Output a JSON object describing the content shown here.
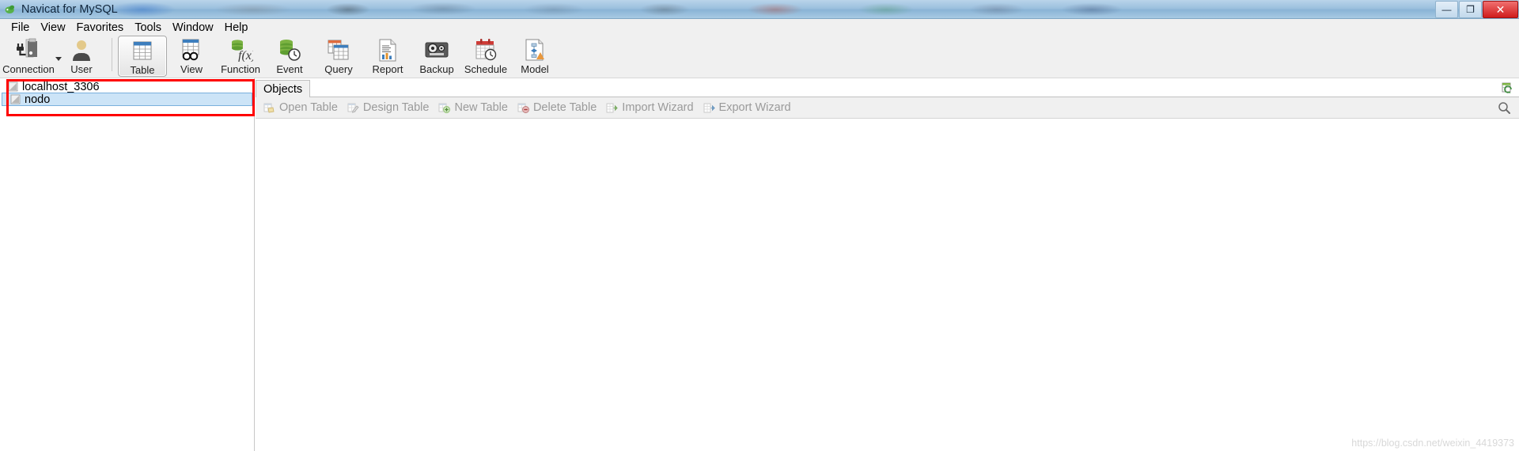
{
  "window": {
    "title": "Navicat for MySQL",
    "app_icon": "navicat-logo-icon",
    "minimize_label": "—",
    "maximize_label": "❐",
    "close_label": "✕"
  },
  "menubar": {
    "items": [
      {
        "label": "File",
        "name": "menu-file"
      },
      {
        "label": "View",
        "name": "menu-view"
      },
      {
        "label": "Favorites",
        "name": "menu-favorites"
      },
      {
        "label": "Tools",
        "name": "menu-tools"
      },
      {
        "label": "Window",
        "name": "menu-window"
      },
      {
        "label": "Help",
        "name": "menu-help"
      }
    ]
  },
  "toolbar": {
    "group1": [
      {
        "label": "Connection",
        "icon": "connection-icon",
        "has_dropdown": true,
        "active": false
      },
      {
        "label": "User",
        "icon": "user-icon",
        "has_dropdown": false,
        "active": false
      }
    ],
    "group2": [
      {
        "label": "Table",
        "icon": "table-icon",
        "has_dropdown": false,
        "active": true
      },
      {
        "label": "View",
        "icon": "view-icon",
        "has_dropdown": false,
        "active": false
      },
      {
        "label": "Function",
        "icon": "function-icon",
        "has_dropdown": false,
        "active": false
      },
      {
        "label": "Event",
        "icon": "event-icon",
        "has_dropdown": false,
        "active": false
      },
      {
        "label": "Query",
        "icon": "query-icon",
        "has_dropdown": false,
        "active": false
      },
      {
        "label": "Report",
        "icon": "report-icon",
        "has_dropdown": false,
        "active": false
      },
      {
        "label": "Backup",
        "icon": "backup-icon",
        "has_dropdown": false,
        "active": false
      },
      {
        "label": "Schedule",
        "icon": "schedule-icon",
        "has_dropdown": false,
        "active": false
      },
      {
        "label": "Model",
        "icon": "model-icon",
        "has_dropdown": false,
        "active": false
      }
    ]
  },
  "tree": {
    "items": [
      {
        "label": "localhost_3306",
        "icon": "connection-node-icon",
        "selected": false,
        "indent": 0
      },
      {
        "label": "nodo",
        "icon": "database-node-icon",
        "selected": true,
        "indent": 0
      }
    ],
    "highlight_color": "#ff0000"
  },
  "right_pane": {
    "tabs": [
      {
        "label": "Objects",
        "active": true
      }
    ],
    "refresh_icon": "refresh-icon",
    "actions": [
      {
        "label": "Open Table",
        "icon": "open-table-icon"
      },
      {
        "label": "Design Table",
        "icon": "design-table-icon"
      },
      {
        "label": "New Table",
        "icon": "new-table-icon"
      },
      {
        "label": "Delete Table",
        "icon": "delete-table-icon"
      },
      {
        "label": "Import Wizard",
        "icon": "import-wizard-icon"
      },
      {
        "label": "Export Wizard",
        "icon": "export-wizard-icon"
      }
    ],
    "search_icon": "search-icon"
  },
  "watermark": {
    "text": "https://blog.csdn.net/weixin_4419373"
  },
  "colors": {
    "accent_blue": "#3d7ebd",
    "selection_blue": "#cce4f7",
    "highlight_red": "#ff0000",
    "toolbar_bg": "#f0f0f0",
    "green": "#6aa84f",
    "orange": "#e07b39"
  }
}
